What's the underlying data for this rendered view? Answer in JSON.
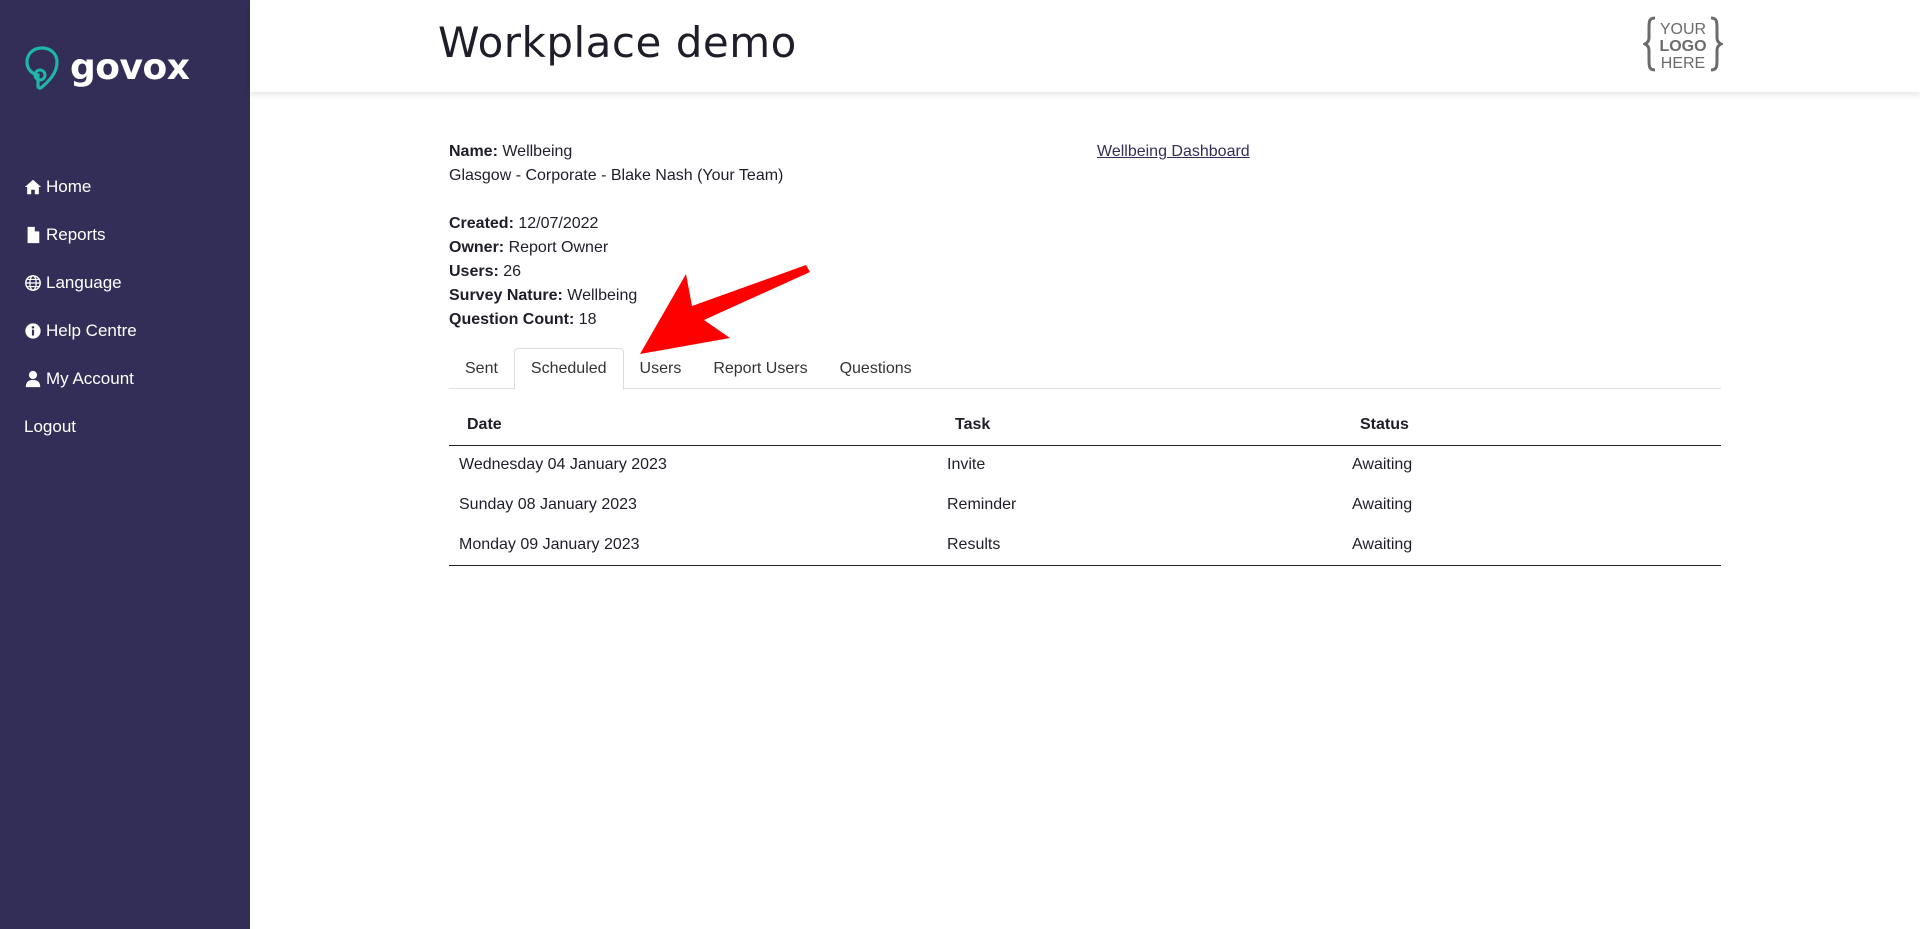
{
  "sidebar": {
    "brand": "govox",
    "items": [
      {
        "label": "Home",
        "icon": "home-icon"
      },
      {
        "label": "Reports",
        "icon": "file-icon"
      },
      {
        "label": "Language",
        "icon": "globe-icon"
      },
      {
        "label": "Help Centre",
        "icon": "info-icon"
      },
      {
        "label": "My Account",
        "icon": "user-icon"
      },
      {
        "label": "Logout",
        "icon": ""
      }
    ]
  },
  "header": {
    "title": "Workplace demo",
    "logo": {
      "line1": "YOUR",
      "line2": "LOGO",
      "line3": "HERE"
    }
  },
  "survey": {
    "name_label": "Name:",
    "name": "Wellbeing",
    "team": "Glasgow - Corporate - Blake Nash (Your Team)",
    "created_label": "Created:",
    "created": "12/07/2022",
    "owner_label": "Owner:",
    "owner": "Report Owner",
    "users_label": "Users:",
    "users": "26",
    "nature_label": "Survey Nature:",
    "nature": "Wellbeing",
    "qcount_label": "Question Count:",
    "qcount": "18",
    "dashboard_link": "Wellbeing Dashboard"
  },
  "tabs": [
    {
      "label": "Sent",
      "active": false
    },
    {
      "label": "Scheduled",
      "active": true
    },
    {
      "label": "Users",
      "active": false
    },
    {
      "label": "Report Users",
      "active": false
    },
    {
      "label": "Questions",
      "active": false
    }
  ],
  "schedule": {
    "columns": [
      "Date",
      "Task",
      "Status"
    ],
    "rows": [
      [
        "Wednesday 04 January 2023",
        "Invite",
        "Awaiting"
      ],
      [
        "Sunday 08 January 2023",
        "Reminder",
        "Awaiting"
      ],
      [
        "Monday 09 January 2023",
        "Results",
        "Awaiting"
      ]
    ]
  },
  "colors": {
    "sidebar": "#332e57",
    "brand_accent": "#1fb5a8",
    "annotation_arrow": "#ff0000"
  }
}
